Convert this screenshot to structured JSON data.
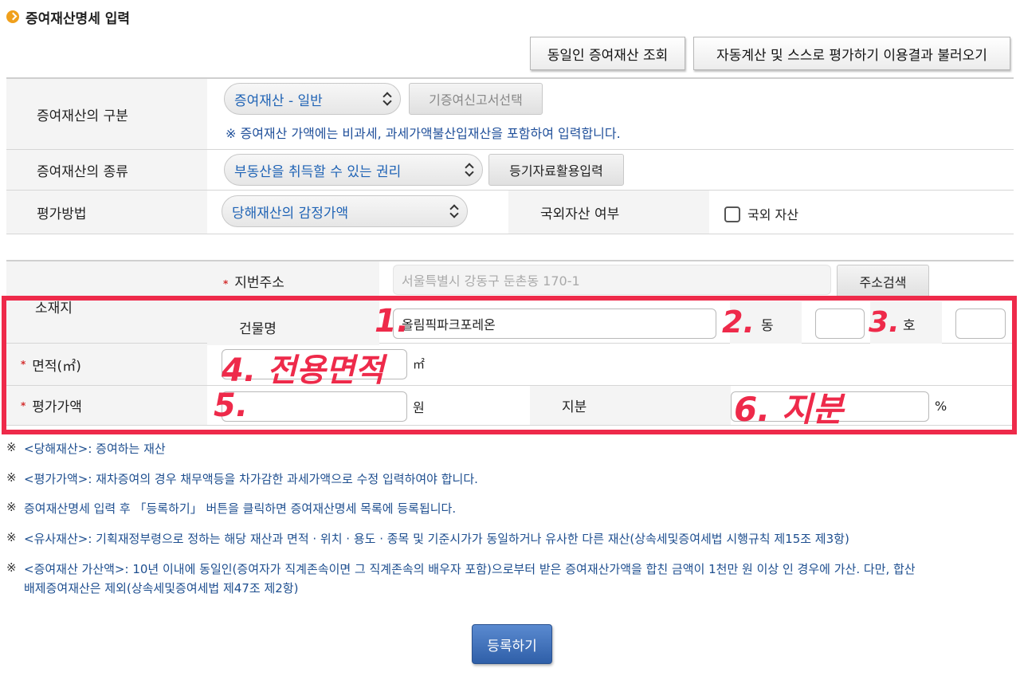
{
  "section_title": "증여재산명세 입력",
  "top_buttons": {
    "same_person": "동일인 증여재산 조회",
    "auto_calc": "자동계산 및 스스로 평가하기 이용결과 불러오기"
  },
  "rows": {
    "category": {
      "label": "증여재산의 구분",
      "select_value": "증여재산 - 일반",
      "button": "기증여신고서선택",
      "note": "※ 증여재산 가액에는 비과세, 과세가액불산입재산을 포함하여 입력합니다."
    },
    "type": {
      "label": "증여재산의 종류",
      "select_value": "부동산을 취득할 수 있는 권리",
      "button": "등기자료활용입력"
    },
    "method": {
      "label": "평가방법",
      "select_value": "당해재산의 감정가액",
      "foreign_label": "국외자산 여부",
      "foreign_checkbox": "국외 자산"
    },
    "location": {
      "label": "소재지",
      "address_label": "지번주소",
      "address_placeholder": "서울특별시 강동구 둔촌동 170-1",
      "search_button": "주소검색",
      "building_label": "건물명",
      "building_value": "올림픽파크포레온",
      "dong_label": "동",
      "ho_label": "호"
    },
    "area": {
      "label": "면적(㎡)",
      "unit": "㎡"
    },
    "value": {
      "label": "평가가액",
      "unit": "원",
      "share_label": "지분",
      "share_unit": "%"
    }
  },
  "annotations": {
    "a1": "1.",
    "a2": "2.",
    "a3": "3.",
    "a4": "4. 전용면적",
    "a5": "5.",
    "a6": "6. 지분"
  },
  "notes": [
    "<당해재산>: 증여하는 재산",
    "<평가가액>: 재차증여의 경우 채무액등을 차가감한 과세가액으로 수정 입력하여야 합니다.",
    "증여재산명세 입력 후 「등록하기」 버튼을 클릭하면 증여재산명세 목록에 등록됩니다.",
    "<유사재산>: 기획재정부령으로 정하는 해당 재산과 면적 · 위치 · 용도 · 종목 및 기준시가가 동일하거나 유사한 다른 재산(상속세및증여세법 시행규칙 제15조 제3항)",
    "<증여재산 가산액>: 10년 이내에 동일인(증여자가 직계존속이면 그 직계존속의 배우자 포함)으로부터 받은 증여재산가액을 합친 금액이 1천만 원 이상 인 경우에 가산. 다만, 합산",
    "배제증여재산은 제외(상속세및증여세법 제47조 제2항)"
  ],
  "note_mark": "※",
  "register_button": "등록하기",
  "colors": {
    "accent_blue": "#1f63b5",
    "annotation_red": "#ee2a4a",
    "title_bullet": "#f0a01c"
  }
}
